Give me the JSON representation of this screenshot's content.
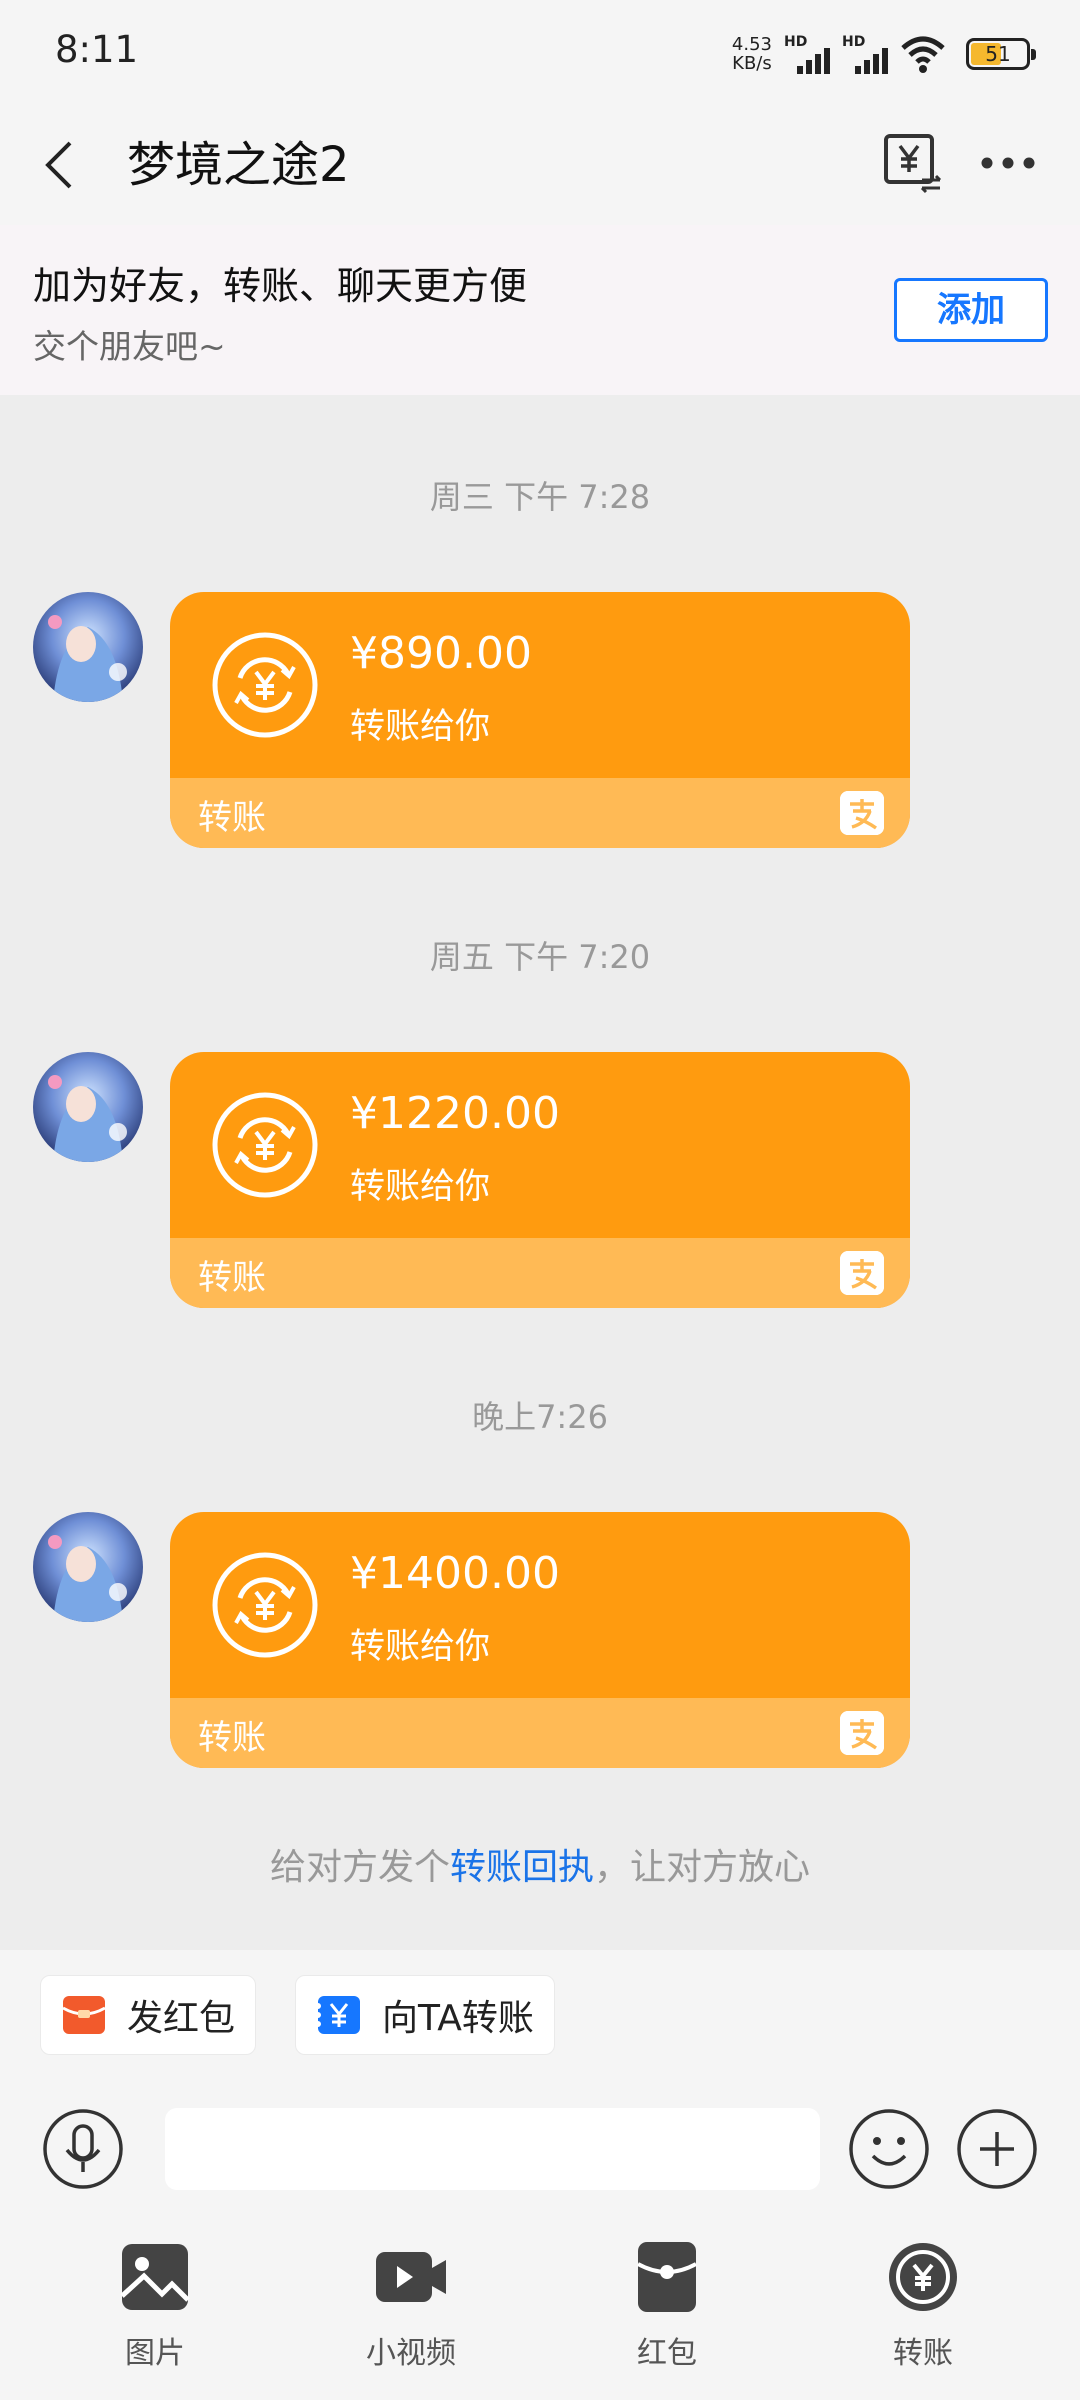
{
  "status_bar": {
    "time": "8:11",
    "net_speed_value": "4.53",
    "net_speed_unit": "KB/s",
    "sim1_label": "HD",
    "sim2_label": "HD",
    "battery_level": "51"
  },
  "header": {
    "title": "梦境之途2"
  },
  "friend_banner": {
    "title": "加为好友，转账、聊天更方便",
    "subtitle": "交个朋友吧~",
    "add_label": "添加"
  },
  "messages": [
    {
      "time": "周三  下午 7:28",
      "amount": "¥890.00",
      "desc": "转账给你",
      "footer": "转账"
    },
    {
      "time": "周五  下午 7:20",
      "amount": "¥1220.00",
      "desc": "转账给你",
      "footer": "转账"
    },
    {
      "time": "晚上7:26",
      "amount": "¥1400.00",
      "desc": "转账给你",
      "footer": "转账"
    }
  ],
  "receipt_hint": {
    "prefix": "给对方发个",
    "link": "转账回执",
    "suffix": "，让对方放心"
  },
  "quick_actions": {
    "red_packet": "发红包",
    "transfer": "向TA转账"
  },
  "toolbar": [
    {
      "label": "图片",
      "icon": "image-icon"
    },
    {
      "label": "小视频",
      "icon": "video-icon"
    },
    {
      "label": "红包",
      "icon": "red-packet-icon"
    },
    {
      "label": "转账",
      "icon": "transfer-icon"
    }
  ],
  "colors": {
    "card_orange": "#ff9b0f",
    "card_footer": "#ffba55",
    "accent_blue": "#1677ff"
  }
}
